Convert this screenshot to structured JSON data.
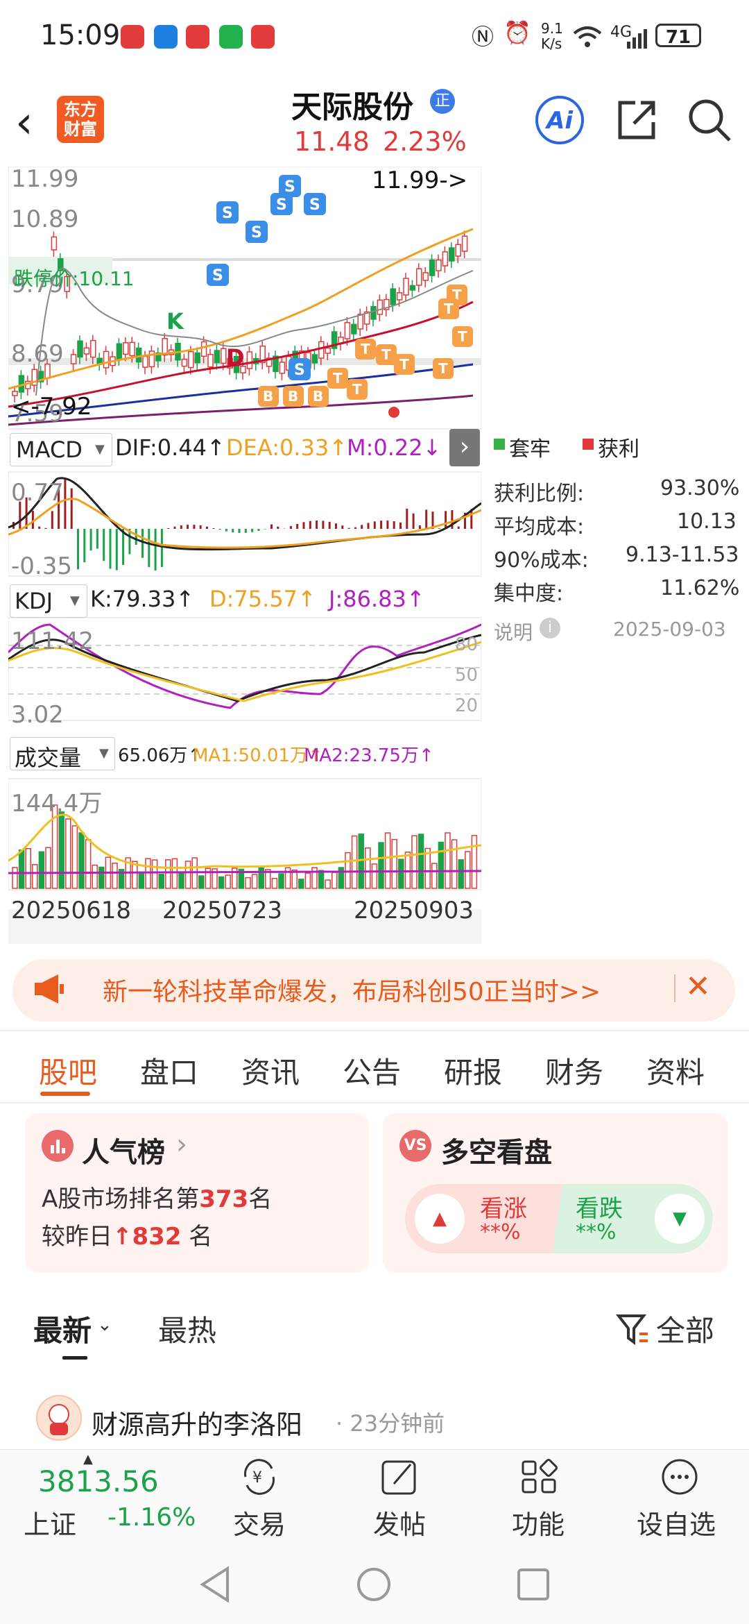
{
  "status_bar": {
    "time": "15:09",
    "net_speed_top": "9.1",
    "net_speed_bottom": "K/s",
    "signal": "4G",
    "battery": "71"
  },
  "header": {
    "logo_line1": "东方",
    "logo_line2": "财富",
    "stock_name": "天际股份",
    "badge": "正",
    "price": "11.48",
    "change_pct": "2.23%",
    "ai_label": "Ai"
  },
  "kline": {
    "y_labels": [
      "11.99",
      "10.89",
      "9.79",
      "8.69",
      "7.59"
    ],
    "high_note": "11.99->",
    "low_note": "<-7.92",
    "limit_down_label": "跌停价:10.11",
    "k_marker": "K",
    "d_marker": "D"
  },
  "macd": {
    "selector": "MACD",
    "dif": "DIF:0.44↑",
    "dea": "DEA:0.33↑",
    "m": "M:0.22↓",
    "y_top": "0.77",
    "y_bottom": "-0.35"
  },
  "kdj": {
    "selector": "KDJ",
    "k": "K:79.33↑",
    "d": "D:75.57↑",
    "j": "J:86.83↑",
    "y_top": "111.42",
    "y_bottom": "3.02",
    "levels": [
      "80",
      "50",
      "20"
    ]
  },
  "volume": {
    "selector": "成交量",
    "vol": "65.06万↑",
    "ma1": "MA1:50.01万↑",
    "ma2": "MA2:23.75万↑",
    "y_top": "144.4万",
    "dates": [
      "20250618",
      "20250723",
      "20250903"
    ]
  },
  "chips": {
    "legend_trapped": "套牢",
    "legend_profit": "获利",
    "rows": [
      {
        "label": "获利比例:",
        "value": "93.30%"
      },
      {
        "label": "平均成本:",
        "value": "10.13"
      },
      {
        "label": "90%成本:",
        "value": "9.13-11.53"
      },
      {
        "label": "集中度:",
        "value": "11.62%"
      }
    ],
    "note_label": "说明",
    "date": "2025-09-03"
  },
  "promo": {
    "text": "新一轮科技革命爆发，布局科创50正当时>>"
  },
  "tabs": [
    "股吧",
    "盘口",
    "资讯",
    "公告",
    "研报",
    "财务",
    "资料"
  ],
  "popularity": {
    "title": "人气榜",
    "rank_prefix": "A股市场排名第",
    "rank": "373",
    "rank_suffix": "名",
    "change_prefix": "较昨日",
    "change": "832",
    "change_suffix": "名"
  },
  "vote": {
    "title": "多空看盘",
    "up_label": "看涨",
    "up_pct": "**%",
    "down_label": "看跌",
    "down_pct": "**%"
  },
  "feed": {
    "filter_latest": "最新",
    "filter_hot": "最热",
    "filter_all": "全部",
    "post_user": "财源高升的李洛阳",
    "post_time": "· 23分钟前"
  },
  "bottom_nav": {
    "index_value": "3813.56",
    "index_name": "上证",
    "index_change": "-1.16%",
    "trade": "交易",
    "post": "发帖",
    "function": "功能",
    "watchlist": "设自选"
  },
  "colors": {
    "accent": "#e85b1e",
    "up_red": "#e03a3a",
    "down_green": "#1aa348",
    "brand_blue": "#2a66e0"
  }
}
